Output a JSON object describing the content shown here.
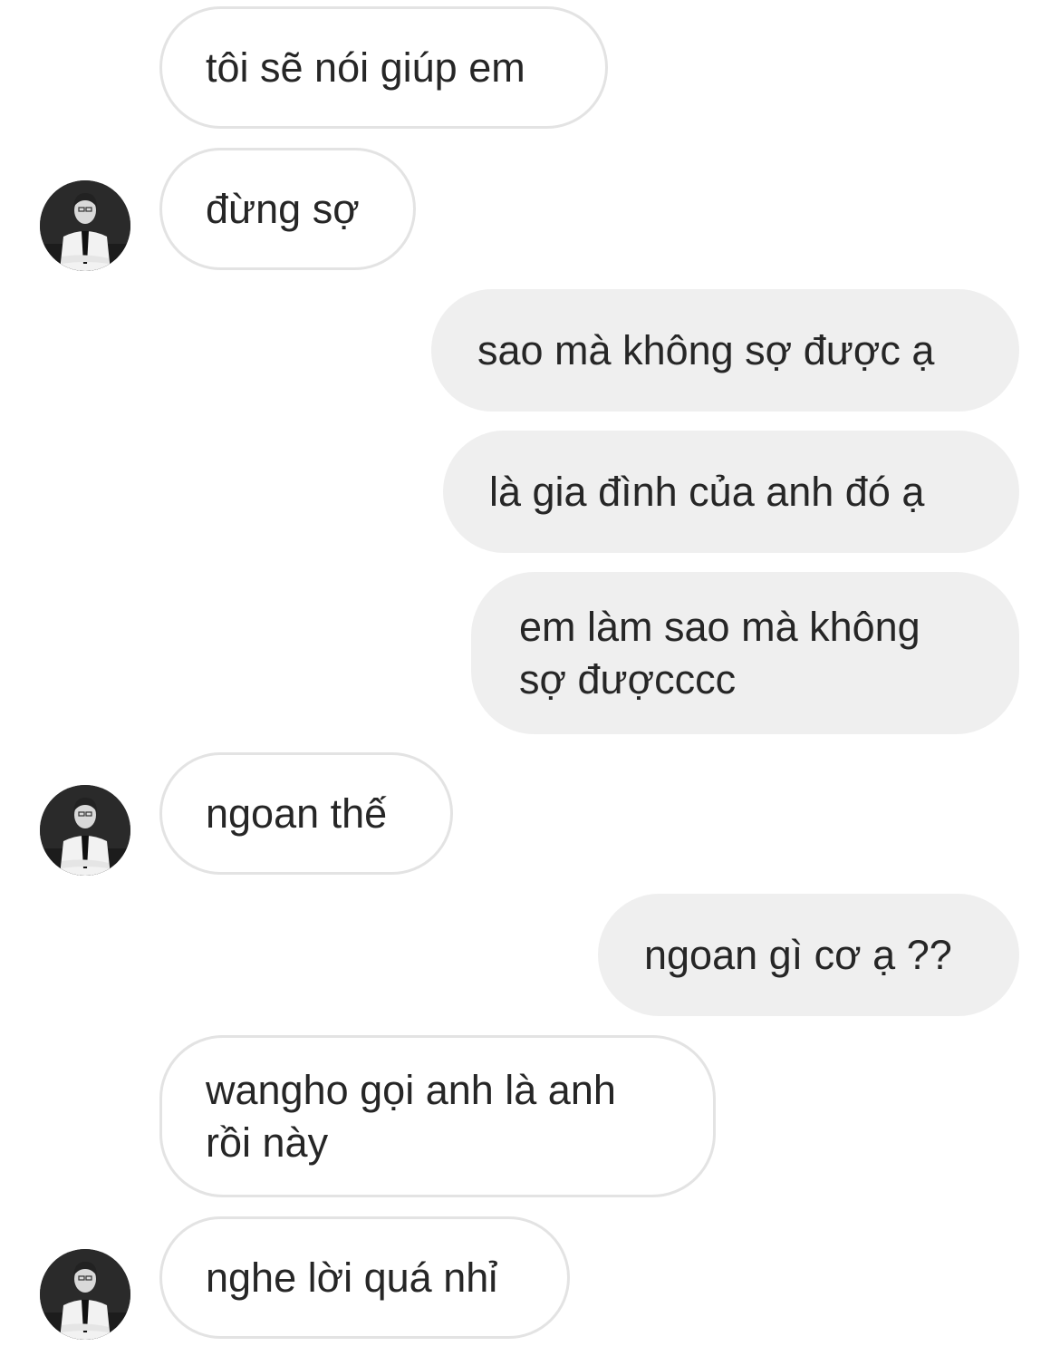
{
  "messages": [
    {
      "sender": "other",
      "text": "tôi sẽ nói giúp em"
    },
    {
      "sender": "other",
      "text": "đừng sợ"
    },
    {
      "sender": "me",
      "text": "sao mà không sợ được ạ"
    },
    {
      "sender": "me",
      "text": "là gia đình của anh đó ạ"
    },
    {
      "sender": "me",
      "text": "em làm sao mà không sợ đượcccc"
    },
    {
      "sender": "other",
      "text": "ngoan thế"
    },
    {
      "sender": "me",
      "text": "ngoan gì cơ ạ ??"
    },
    {
      "sender": "other",
      "text": "wangho gọi anh là anh rồi này"
    },
    {
      "sender": "other",
      "text": "nghe lời quá nhỉ"
    }
  ],
  "avatar": {
    "icon": "person-in-suit-avatar",
    "style": "black-and-white photo"
  }
}
